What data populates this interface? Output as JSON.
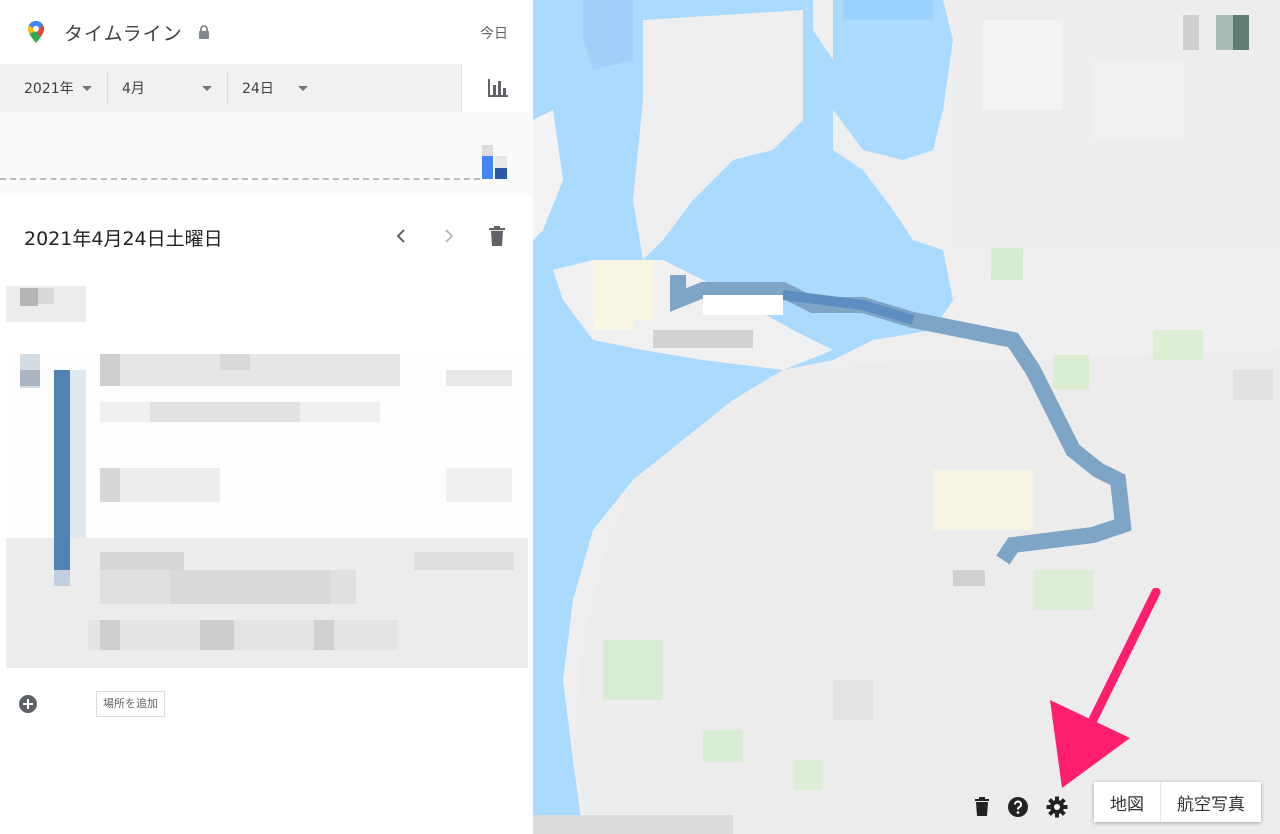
{
  "header": {
    "title": "タイムライン",
    "today_label": "今日"
  },
  "date_selector": {
    "year": "2021年",
    "month": "4月",
    "day": "24日"
  },
  "day_view": {
    "date_title": "2021年4月24日土曜日"
  },
  "timeline": {
    "add_place_label": "場所を追加"
  },
  "map": {
    "map_type_buttons": [
      "地図",
      "航空写真"
    ]
  },
  "colors": {
    "accent_blue": "#4285f4",
    "path_blue": "#4a7fb5",
    "water": "#aadaff",
    "annotation_pink": "#ff1f6e"
  }
}
